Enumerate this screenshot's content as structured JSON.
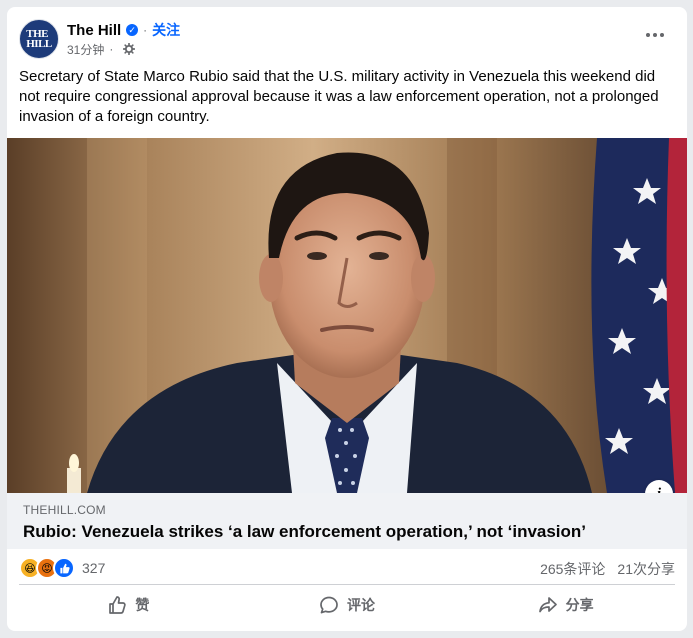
{
  "post": {
    "page_name": "The Hill",
    "follow_label": "关注",
    "time": "31分钟",
    "avatar_text": "THE HILL",
    "text": "Secretary of State Marco Rubio said that the U.S. military activity in Venezuela this weekend did not require congressional approval because it was a law enforcement operation, not a prolonged invasion of a foreign country."
  },
  "link": {
    "domain": "THEHILL.COM",
    "title": "Rubio: Venezuela strikes ‘a law enforcement operation,’ not ‘invasion’"
  },
  "stats": {
    "reaction_count": "327",
    "comments": "265条评论",
    "shares": "21次分享",
    "reaction_icons": [
      "haha-icon",
      "angry-icon",
      "like-icon"
    ]
  },
  "actions": {
    "like_label": "赞",
    "comment_label": "评论",
    "share_label": "分享"
  },
  "colors": {
    "accent": "#0866ff",
    "muted_text": "#65676b"
  }
}
